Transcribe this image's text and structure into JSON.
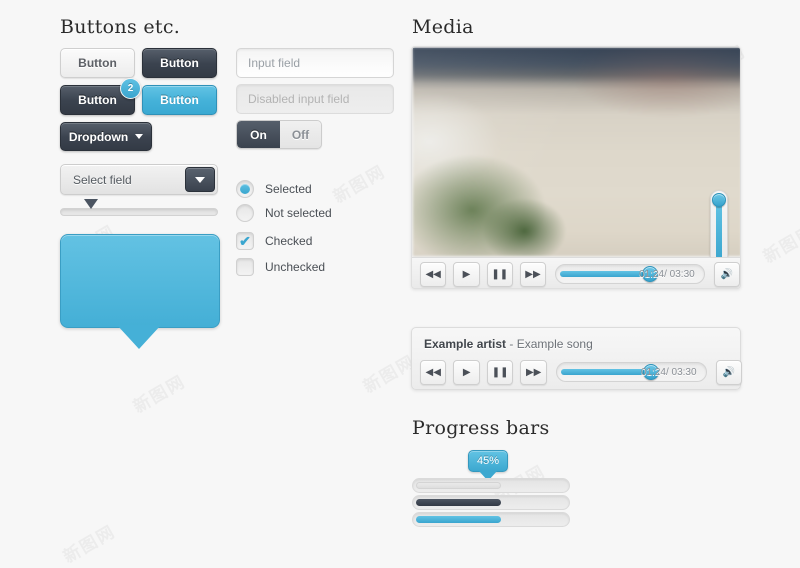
{
  "sections": {
    "buttons_title": "Buttons etc.",
    "media_title": "Media",
    "progress_title": "Progress bars"
  },
  "buttons": {
    "light": "Button",
    "dark": "Button",
    "dark_badged": "Button",
    "badge_count": "2",
    "blue": "Button",
    "dropdown": "Dropdown"
  },
  "select": {
    "value": "Select field",
    "arrow_icon": "caret-down-icon"
  },
  "slider": {
    "thumb_icon": "triangle-down-thumb"
  },
  "bubble": {
    "text": "",
    "color": "#45b0d7"
  },
  "inputs": {
    "field_value": "Input field",
    "field_placeholder": "Input field",
    "disabled_placeholder": "Disabled input field"
  },
  "toggle": {
    "on_label": "On",
    "off_label": "Off",
    "selected": "On"
  },
  "choices": [
    {
      "type": "radio",
      "label": "Selected",
      "checked": true
    },
    {
      "type": "radio",
      "label": "Not selected",
      "checked": false
    },
    {
      "type": "checkbox",
      "label": "Checked",
      "checked": true,
      "mark": "✔"
    },
    {
      "type": "checkbox",
      "label": "Unchecked",
      "checked": false,
      "mark": ""
    }
  ],
  "video_player": {
    "controls": [
      {
        "icon": "rewind-icon",
        "glyph": "◀◀"
      },
      {
        "icon": "play-icon",
        "glyph": "▶"
      },
      {
        "icon": "pause-icon",
        "glyph": "❚❚"
      },
      {
        "icon": "fast-forward-icon",
        "glyph": "▶▶"
      }
    ],
    "time": "01:24/ 03:30",
    "volume_icon": "speaker-icon",
    "volume_glyph": "🔊",
    "progress_percent": 63,
    "volume_percent": 92
  },
  "audio_player": {
    "artist": "Example artist",
    "separator": " - ",
    "song": "Example song",
    "controls": [
      {
        "icon": "rewind-icon",
        "glyph": "◀◀"
      },
      {
        "icon": "play-icon",
        "glyph": "▶"
      },
      {
        "icon": "pause-icon",
        "glyph": "❚❚"
      },
      {
        "icon": "fast-forward-icon",
        "glyph": "▶▶"
      }
    ],
    "time": "01:24/ 03:30",
    "volume_icon": "speaker-icon",
    "volume_glyph": "🔊",
    "progress_percent": 63
  },
  "progress": {
    "tooltip": "45%",
    "bars": [
      {
        "style": "grey",
        "percent": 54
      },
      {
        "style": "dark",
        "percent": 54
      },
      {
        "style": "blue",
        "percent": 54
      }
    ]
  },
  "watermark": "新图网"
}
